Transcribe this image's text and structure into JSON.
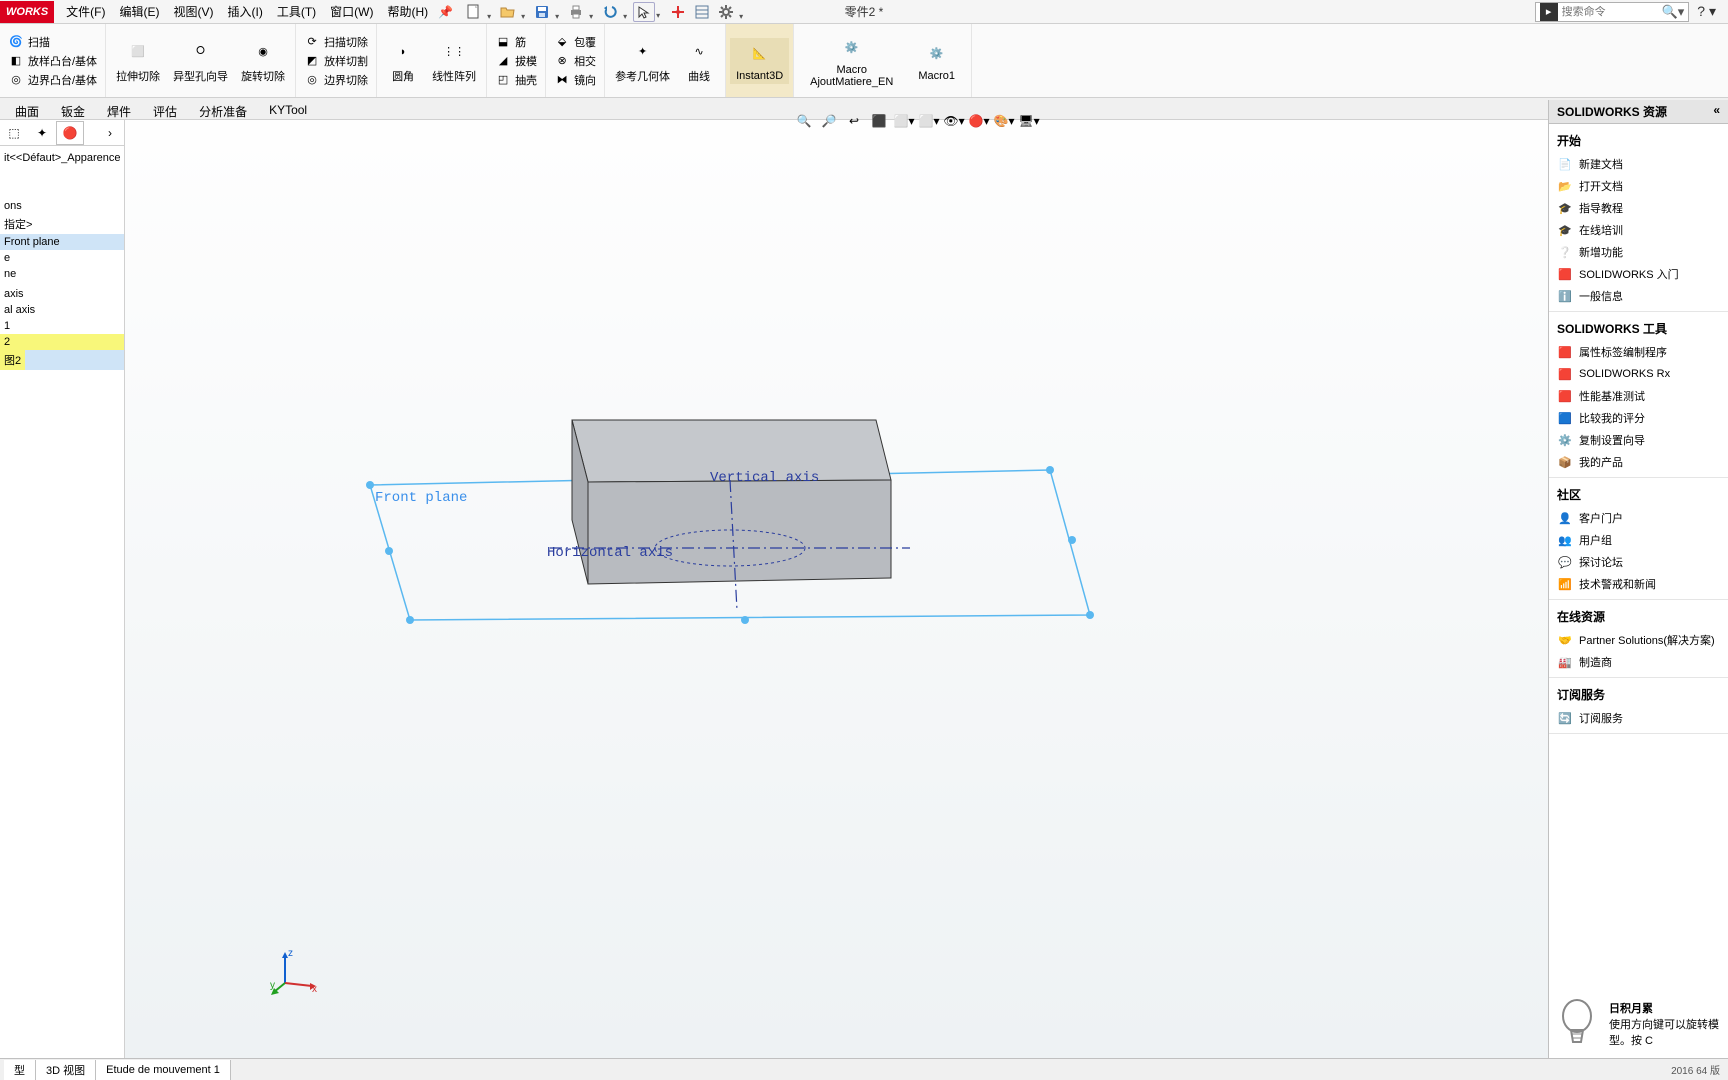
{
  "app": {
    "logo": "WORKS"
  },
  "menu": {
    "file": "文件(F)",
    "edit": "编辑(E)",
    "view": "视图(V)",
    "insert": "插入(I)",
    "tools": "工具(T)",
    "window": "窗口(W)",
    "help": "帮助(H)"
  },
  "docTitle": "零件2 *",
  "search": {
    "placeholder": "搜索命令"
  },
  "ribbon": {
    "sweep": "扫描",
    "loft": "放样凸台/基体",
    "boundary": "边界凸台/基体",
    "extrudeCut": "拉伸切除",
    "holeWizard": "异型孔向导",
    "revCut": "旋转切除",
    "sweepCut": "扫描切除",
    "loftCut": "放样切割",
    "bndCut": "边界切除",
    "fillet": "圆角",
    "linPat": "线性阵列",
    "rib": "筋",
    "draft": "拔模",
    "shell": "抽壳",
    "wrap": "包覆",
    "intersect": "相交",
    "mirror": "镜向",
    "refGeom": "参考几何体",
    "curve": "曲线",
    "instant": "Instant3D",
    "macro1": "Macro",
    "macro1b": "AjoutMatiere_EN",
    "macro2": "Macro1"
  },
  "cmdTabs": [
    "曲面",
    "钣金",
    "焊件",
    "评估",
    "分析准备",
    "KYTool"
  ],
  "tree": {
    "head": "it<<Défaut>_Apparence Et",
    "items": [
      "ons",
      "指定>",
      "Front plane",
      "e",
      "ne",
      "",
      "axis",
      "al axis",
      "1",
      "2",
      "图2"
    ]
  },
  "viewport": {
    "frontPlane": "Front plane",
    "vAxis": "Vertical axis",
    "hAxis": "Horizontal axis",
    "triad": {
      "x": "x",
      "y": "y",
      "z": "z"
    }
  },
  "taskPane": {
    "title": "SOLIDWORKS 资源",
    "begin": "开始",
    "beginItems": [
      "新建文档",
      "打开文档",
      "指导教程",
      "在线培训",
      "新增功能",
      "SOLIDWORKS 入门",
      "一般信息"
    ],
    "tools": "SOLIDWORKS 工具",
    "toolsItems": [
      "属性标签编制程序",
      "SOLIDWORKS Rx",
      "性能基准测试",
      "比较我的评分",
      "复制设置向导",
      "我的产品"
    ],
    "community": "社区",
    "communityItems": [
      "客户门户",
      "用户组",
      "探讨论坛",
      "技术警戒和新闻"
    ],
    "online": "在线资源",
    "onlineItems": [
      "Partner Solutions(解决方案)",
      "制造商"
    ],
    "sub": "订阅服务",
    "subItems": [
      "订阅服务"
    ],
    "daily": "日积月累",
    "dailyTip": "使用方向键可以旋转模型。按 C"
  },
  "bottomTabs": [
    "型",
    "3D 视图",
    "Etude de mouvement 1"
  ],
  "statusHint": "2016  64 版"
}
